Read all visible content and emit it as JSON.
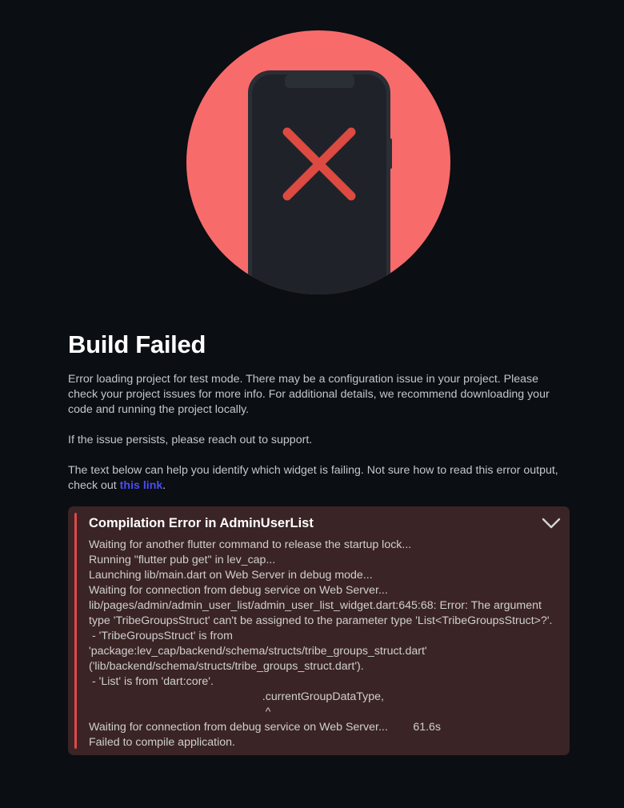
{
  "colors": {
    "background": "#0b0e12",
    "hero_circle": "#f86b6b",
    "phone_body": "#21252b",
    "x_mark": "#dc4a42",
    "link": "#4b4cf0",
    "error_bg": "#3b2425",
    "error_accent": "#e04848"
  },
  "hero": {
    "icon": "phone-with-x-icon"
  },
  "main": {
    "title": "Build Failed",
    "paragraph1": "Error loading project for test mode. There may be a configuration issue in your project. Please check your project issues for more info. For additional details, we recommend downloading your code and running the project locally.",
    "paragraph2": "If the issue persists, please reach out to support.",
    "paragraph3_text": "The text below can help you identify which widget is failing. Not sure how to read this error output, check out ",
    "paragraph3_link": "this link",
    "paragraph3_end": "."
  },
  "error": {
    "title": "Compilation Error in AdminUserList",
    "toggle_icon": "chevron-down-icon",
    "log": "Waiting for another flutter command to release the startup lock...\nRunning \"flutter pub get\" in lev_cap...\nLaunching lib/main.dart on Web Server in debug mode...\nWaiting for connection from debug service on Web Server...\nlib/pages/admin/admin_user_list/admin_user_list_widget.dart:645:68: Error: The argument type 'TribeGroupsStruct' can't be assigned to the parameter type 'List<TribeGroupsStruct>?'.\n - 'TribeGroupsStruct' is from 'package:lev_cap/backend/schema/structs/tribe_groups_struct.dart' ('lib/backend/schema/structs/tribe_groups_struct.dart').\n - 'List' is from 'dart:core'.\n                                                       .currentGroupDataType,\n                                                        ^\nWaiting for connection from debug service on Web Server...        61.6s\nFailed to compile application."
  }
}
